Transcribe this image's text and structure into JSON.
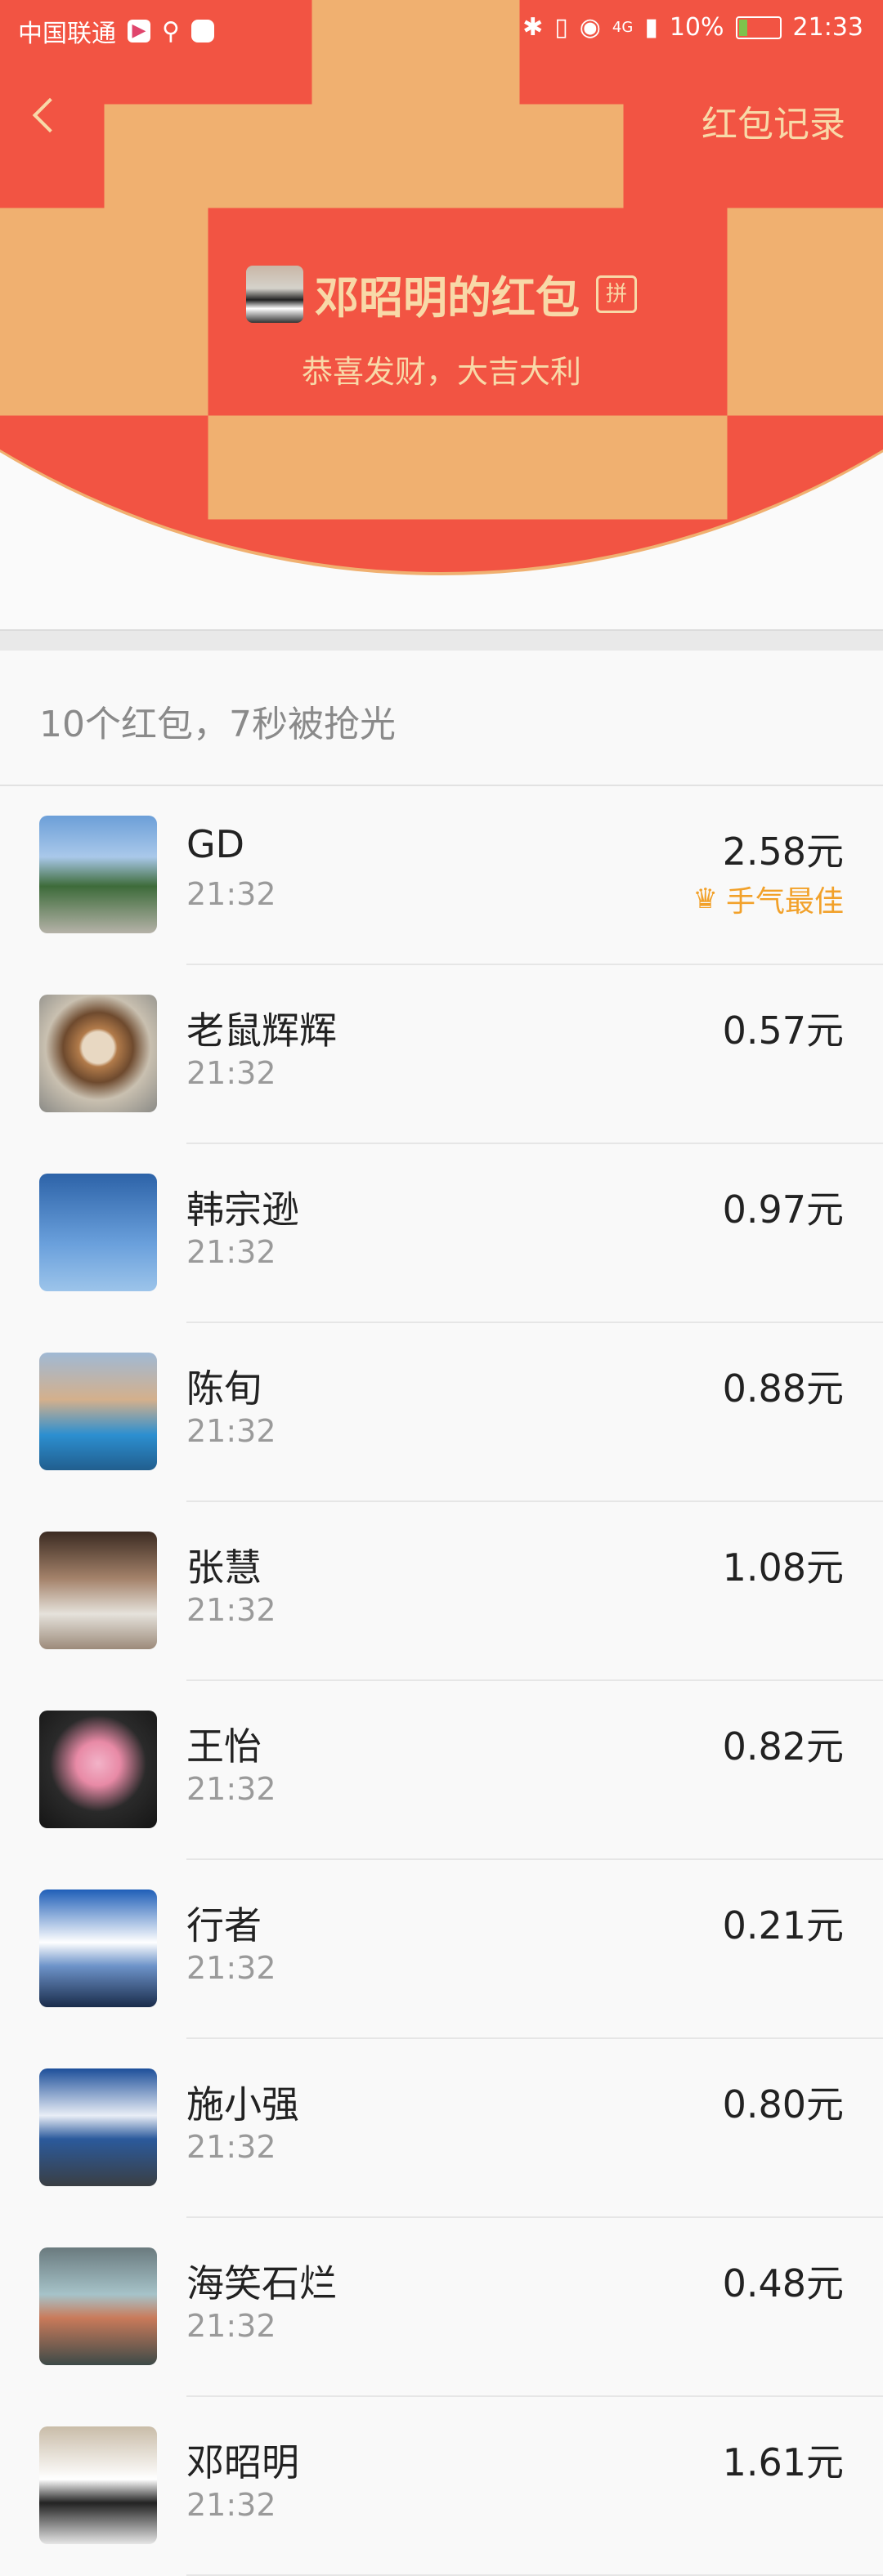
{
  "status_bar": {
    "carrier": "中国联通",
    "battery": "10%",
    "time": "21:33",
    "network": "4G"
  },
  "header": {
    "back_icon": "chevron-left-icon",
    "records_label": "红包记录"
  },
  "packet": {
    "sender_title": "邓昭明的红包",
    "pin_tag": "拼",
    "wish": "恭喜发财，大吉大利"
  },
  "summary": "10个红包，7秒被抢光",
  "recipients": [
    {
      "name": "GD",
      "time": "21:32",
      "amount": "2.58元",
      "best": "手气最佳"
    },
    {
      "name": "老鼠辉辉",
      "time": "21:32",
      "amount": "0.57元"
    },
    {
      "name": "韩宗逊",
      "time": "21:32",
      "amount": "0.97元"
    },
    {
      "name": "陈旬",
      "time": "21:32",
      "amount": "0.88元"
    },
    {
      "name": "张慧",
      "time": "21:32",
      "amount": "1.08元"
    },
    {
      "name": "王怡",
      "time": "21:32",
      "amount": "0.82元"
    },
    {
      "name": "行者",
      "time": "21:32",
      "amount": "0.21元"
    },
    {
      "name": "施小强",
      "time": "21:32",
      "amount": "0.80元"
    },
    {
      "name": "海笑石烂",
      "time": "21:32",
      "amount": "0.48元"
    },
    {
      "name": "邓昭明",
      "time": "21:32",
      "amount": "1.61元"
    }
  ],
  "colors": {
    "header_red": "#f25443",
    "gold_text": "#f8d9a8",
    "best_orange": "#f2a12a"
  }
}
